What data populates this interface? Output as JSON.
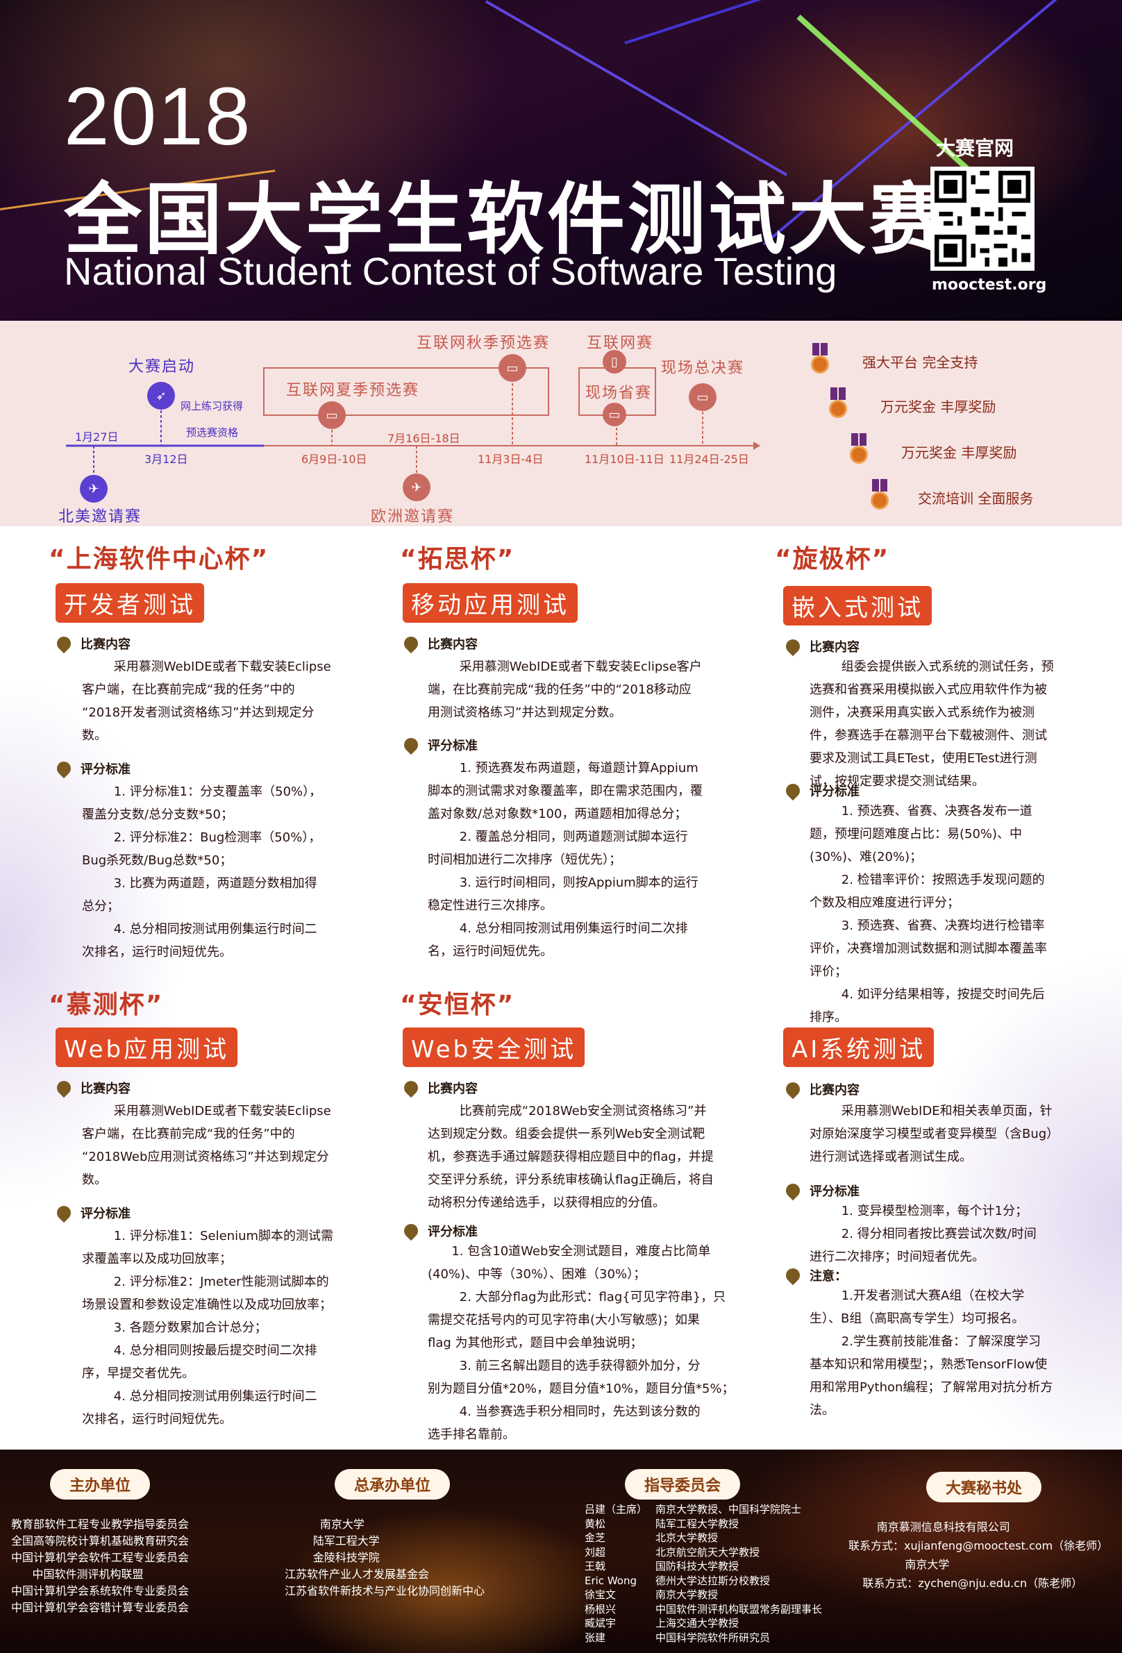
{
  "header": {
    "year": "2018",
    "title_cn": "全国大学生软件测试大赛",
    "title_en": "National Student Contest of Software Testing",
    "qr_label": "大赛官网",
    "site": "mooctest.org"
  },
  "timeline": {
    "start_label": "大赛启动",
    "practice_label": "网上练习获得",
    "qual_label": "预选赛资格",
    "date_jan27": "1月27日",
    "date_mar12": "3月12日",
    "north_america": "北美邀请赛",
    "summer": "互联网夏季预选赛",
    "summer_date": "6月9日-10日",
    "europe_date": "7月16日-18日",
    "europe": "欧洲邀请赛",
    "autumn": "互联网秋季预选赛",
    "autumn_date": "11月3日-4日",
    "internet": "互联网赛",
    "provincial": "现场省赛",
    "prov_date": "11月10日-11日",
    "finals": "现场总决赛",
    "finals_date": "11月24日-25日"
  },
  "awards": [
    "强大平台 完全支持",
    "万元奖金 丰厚奖励",
    "万元奖金 丰厚奖励",
    "交流培训 全面服务"
  ],
  "cups": [
    {
      "name": "“上海软件中心杯”",
      "tag": "开发者测试",
      "h1": "比赛内容",
      "b1": "        采用慕测WebIDE或者下载安装Eclipse\n客户端，在比赛前完成“我的任务”中的\n“2018开发者测试资格练习”并达到规定分\n数。",
      "h2": "评分标准",
      "b2": "        1. 评分标准1：分支覆盖率（50%），\n覆盖分支数/总分支数*50；\n        2. 评分标准2：Bug检测率（50%），\nBug杀死数/Bug总数*50；\n        3. 比赛为两道题，两道题分数相加得\n总分；\n        4. 总分相同按测试用例集运行时间二\n次排名，运行时间短优先。"
    },
    {
      "name": "“拓思杯”",
      "tag": "移动应用测试",
      "h1": "比赛内容",
      "b1": "        采用慕测WebIDE或者下载安装Eclipse客户\n端，在比赛前完成“我的任务”中的“2018移动应\n用测试资格练习”并达到规定分数。",
      "h2": "评分标准",
      "b2": "        1. 预选赛发布两道题，每道题计算Appium\n脚本的测试需求对象覆盖率，即在需求范围内，覆\n盖对象数/总对象数*100，两道题相加得总分；\n        2. 覆盖总分相同，则两道题测试脚本运行\n时间相加进行二次排序（短优先）；\n        3. 运行时间相同，则按Appium脚本的运行\n稳定性进行三次排序。\n        4. 总分相同按测试用例集运行时间二次排\n名，运行时间短优先。"
    },
    {
      "name": "“旋极杯”",
      "tag": "嵌入式测试",
      "h1": "比赛内容",
      "b1": "        组委会提供嵌入式系统的测试任务，预\n选赛和省赛采用模拟嵌入式应用软件作为被\n测件，决赛采用真实嵌入式系统作为被测\n件，参赛选手在慕测平台下载被测件、测试\n要求及测试工具ETest，使用ETest进行测\n试，按规定要求提交测试结果。",
      "h2": "评分标准",
      "b2": "        1. 预选赛、省赛、决赛各发布一道\n题，预埋问题难度占比：易(50%)、中\n(30%)、难(20%)；\n        2. 检错率评价：按照选手发现问题的\n个数及相应难度进行评分；\n        3. 预选赛、省赛、决赛均进行检错率\n评价，决赛增加测试数据和测试脚本覆盖率\n评价；\n        4. 如评分结果相等，按提交时间先后\n排序。"
    },
    {
      "name": "“慕测杯”",
      "tag": "Web应用测试",
      "h1": "比赛内容",
      "b1": "        采用慕测WebIDE或者下载安装Eclipse\n客户端，在比赛前完成“我的任务”中的\n“2018Web应用测试资格练习”并达到规定分\n数。",
      "h2": "评分标准",
      "b2": "        1. 评分标准1：Selenium脚本的测试需\n求覆盖率以及成功回放率；\n        2. 评分标准2：Jmeter性能测试脚本的\n场景设置和参数设定准确性以及成功回放率；\n        3. 各题分数累加合计总分；\n        4. 总分相同则按最后提交时间二次排\n序，早提交者优先。\n        4. 总分相同按测试用例集运行时间二\n次排名，运行时间短优先。"
    },
    {
      "name": "“安恒杯”",
      "tag": "Web安全测试",
      "h1": "比赛内容",
      "b1": "        比赛前完成“2018Web安全测试资格练习”并\n达到规定分数。组委会提供一系列Web安全测试靶\n机，参赛选手通过解题获得相应题目中的flag，并提\n交至评分系统，评分系统审核确认flag正确后，将自\n动将积分传递给选手，以获得相应的分值。",
      "h2": "评分标准",
      "b2": "      1. 包含10道Web安全测试题目，难度占比简单\n(40%)、中等（30%）、困难（30%）；\n        2. 大部分flag为此形式：flag{可见字符串}，只\n需提交花括号内的可见字符串(大小写敏感)；如果\nflag 为其他形式，题目中会单独说明；\n        3. 前三名解出题目的选手获得额外加分，分\n别为题目分值*20%，题目分值*10%，题目分值*5%；\n        4. 当参赛选手积分相同时，先达到该分数的\n选手排名靠前。"
    },
    {
      "name": "",
      "tag": "AI系统测试",
      "h1": "比赛内容",
      "b1": "        采用慕测WebIDE和相关表单页面，针\n对原始深度学习模型或者变异模型（含Bug）\n进行测试选择或者测试生成。",
      "h2": "评分标准",
      "b2": "        1. 变异模型检测率，每个计1分；\n        2. 得分相同者按比赛尝试次数/时间\n进行二次排序；时间短者优先。",
      "h3": "注意：",
      "b3": "        1.开发者测试大赛A组（在校大学\n生）、B组（高职高专学生）均可报名。\n        2.学生赛前技能准备：了解深度学习\n基本知识和常用模型；，熟悉TensorFlow使\n用和常用Python编程；了解常用对抗分析方\n法。"
    }
  ],
  "footer": {
    "host_label": "主办单位",
    "host": "教育部软件工程专业教学指导委员会\n全国高等院校计算机基础教育研究会\n中国计算机学会软件工程专业委员会\n      中国软件测评机构联盟\n中国计算机学会系统软件专业委员会\n中国计算机学会容错计算专业委员会",
    "org_label": "总承办单位",
    "org": "          南京大学\n        陆军工程大学\n        金陵科技学院\n江苏软件产业人才发展基金会\n江苏省软件新技术与产业化协同创新中心",
    "guide_label": "指导委员会",
    "guide_names": "吕建（主席）\n黄松\n金芝\n刘超\n王戟\nEric Wong\n徐宝文\n杨根兴\n臧斌宇\n张建",
    "guide_titles": "南京大学教授、中国科学院院士\n陆军工程大学教授\n北京大学教授\n北京航空航天大学教授\n国防科技大学教授\n德州大学达拉斯分校教授\n南京大学教授\n中国软件测评机构联盟常务副理事长\n上海交通大学教授\n中国科学院软件所研究员",
    "sec_label": "大赛秘书处",
    "sec": "        南京慕测信息科技有限公司\n联系方式：xujianfeng@mooctest.com（徐老师）\n                南京大学\n    联系方式：zychen@nju.edu.cn（陈老师）"
  }
}
